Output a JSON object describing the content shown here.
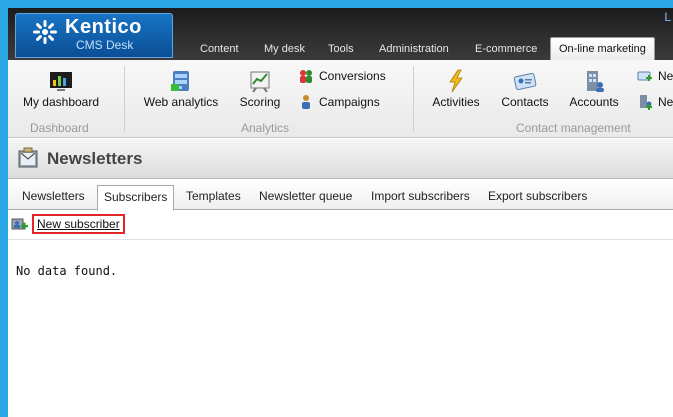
{
  "header": {
    "logo_title": "Kentico",
    "logo_subtitle": "CMS Desk",
    "top_right_link": "L",
    "tabs": [
      {
        "label": "Content"
      },
      {
        "label": "My desk"
      },
      {
        "label": "Tools"
      },
      {
        "label": "Administration"
      },
      {
        "label": "E-commerce"
      },
      {
        "label": "On-line marketing"
      }
    ]
  },
  "ribbon": {
    "dashboard": {
      "btn": "My dashboard",
      "group": "Dashboard"
    },
    "analytics": {
      "web_analytics": "Web analytics",
      "scoring": "Scoring",
      "conversions": "Conversions",
      "campaigns": "Campaigns",
      "group": "Analytics"
    },
    "contact_mgmt": {
      "activities": "Activities",
      "contacts": "Contacts",
      "accounts": "Accounts",
      "new1": "Ne",
      "new2": "Ne",
      "group": "Contact management"
    }
  },
  "page": {
    "title": "Newsletters"
  },
  "subtabs": [
    {
      "label": "Newsletters"
    },
    {
      "label": "Subscribers"
    },
    {
      "label": "Templates"
    },
    {
      "label": "Newsletter queue"
    },
    {
      "label": "Import subscribers"
    },
    {
      "label": "Export subscribers"
    }
  ],
  "actions": {
    "new_subscriber": "New subscriber"
  },
  "content": {
    "empty_message": "No data found."
  },
  "colors": {
    "accent": "#2aa8e6",
    "highlight": "#e0252b"
  }
}
